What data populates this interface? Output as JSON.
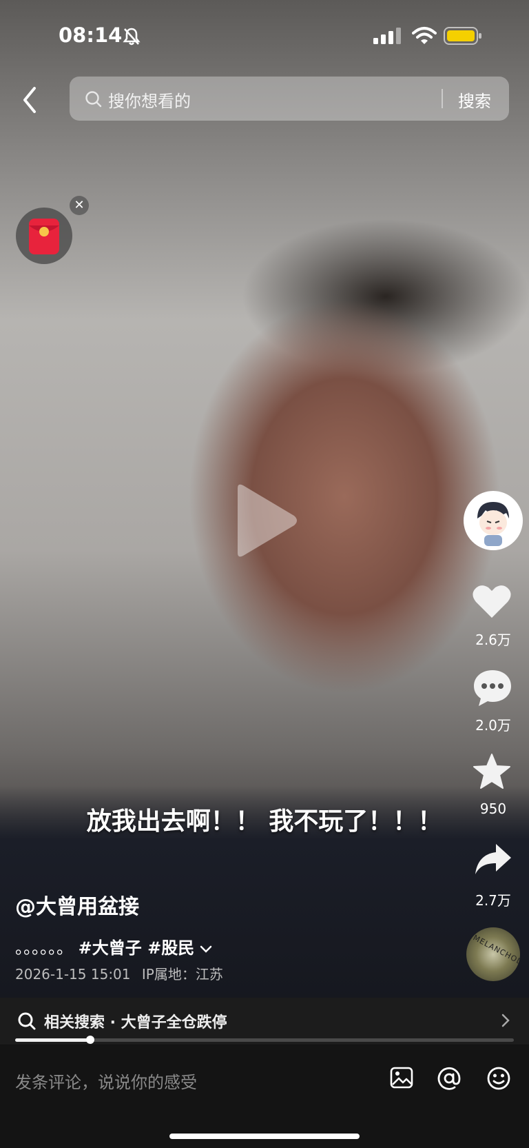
{
  "status_bar": {
    "time": "08:14",
    "icons": [
      "bell-muted-icon",
      "cellular-signal-icon",
      "wifi-icon",
      "battery-icon"
    ],
    "battery_color": "#f5d000"
  },
  "search": {
    "placeholder": "搜你想看的",
    "button": "搜索"
  },
  "overlay": {
    "subtitle": "放我出去啊！！ 我不玩了！！！"
  },
  "side_actions": {
    "likes": "2.6万",
    "comments": "2.0万",
    "favorites": "950",
    "shares": "2.7万",
    "music_disc_text": "MELANCHOL"
  },
  "post": {
    "author": "@大曾用盆接",
    "description_prefix": "。。。。。。",
    "tags": "#大曾子 #股民",
    "date": "2026-1-15 15:01",
    "ip_location": "IP属地：江苏"
  },
  "related": {
    "text": "相关搜索 · 大曾子全仓跌停"
  },
  "playback": {
    "progress": 0.15
  },
  "comment_bar": {
    "placeholder": "发条评论，说说你的感受"
  },
  "colors": {
    "accent_red": "#e8233c",
    "background": "#141414"
  }
}
